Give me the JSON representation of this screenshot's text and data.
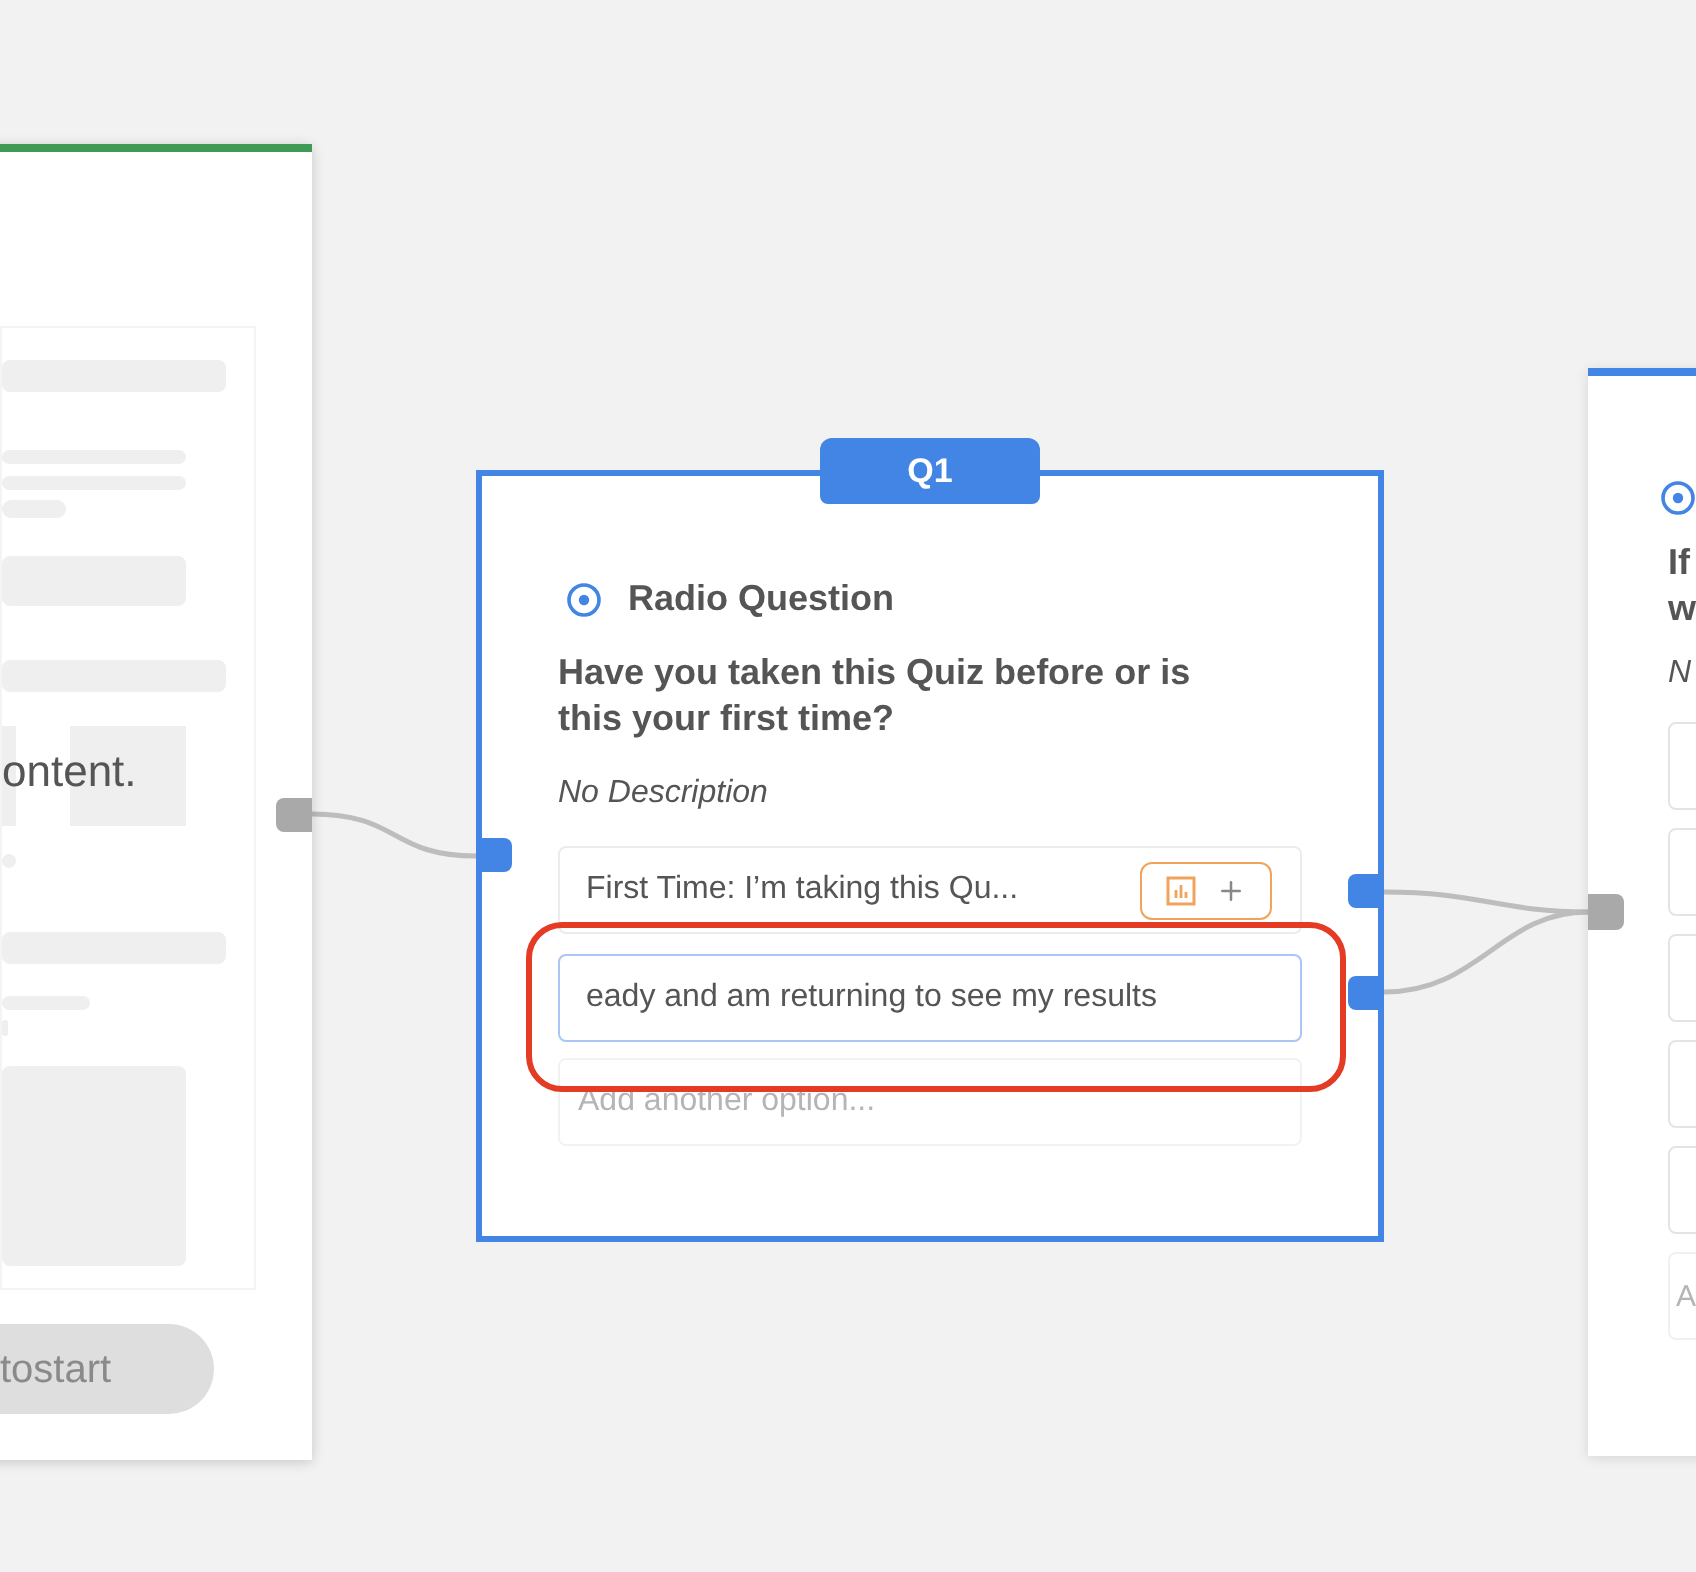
{
  "left_card": {
    "content_text": "ontent.",
    "button": "tostart"
  },
  "question_card": {
    "badge": "Q1",
    "type_label": "Radio Question",
    "question": "Have you taken this Quiz before or is this your first time?",
    "description": "No Description",
    "options": [
      {
        "kind": "option",
        "text": "First Time: I’m taking this Qu..."
      },
      {
        "kind": "editing",
        "text": "eady and am returning to see my results"
      }
    ],
    "add_placeholder": "Add another option...",
    "highlighted": true
  },
  "right_card": {
    "question_lines": [
      "If",
      "w"
    ],
    "description": "N",
    "options": [
      {
        "kind": "blank"
      },
      {
        "kind": "blank"
      },
      {
        "kind": "blank"
      },
      {
        "kind": "blank"
      },
      {
        "kind": "blank"
      }
    ],
    "add_placeholder": "A"
  }
}
